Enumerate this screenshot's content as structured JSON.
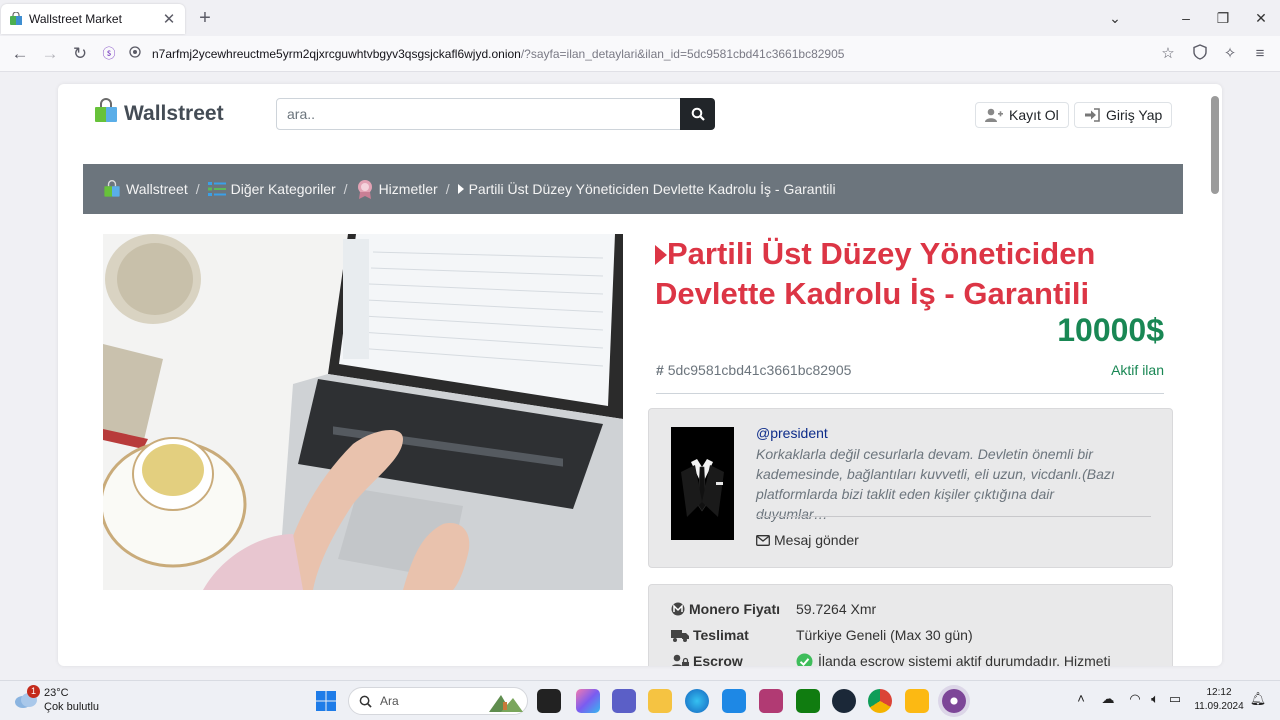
{
  "browser": {
    "tab_title": "Wallstreet Market",
    "url_host": "n7arfmj2ycewhreuctme5yrm2qjxrcguwhtvbgyv3qsgsjckafl6wjyd.onion",
    "url_rest": "/?sayfa=ilan_detaylari&ilan_id=5dc9581cbd41c3661bc82905"
  },
  "site": {
    "logo_text": "Wallstreet",
    "search_placeholder": "ara..",
    "register_label": "Kayıt Ol",
    "login_label": "Giriş Yap"
  },
  "breadcrumb": {
    "home": "Wallstreet",
    "category": "Diğer Kategoriler",
    "subcategory": "Hizmetler",
    "current": "Partili Üst Düzey Yöneticiden Devlette Kadrolu İş - Garantili"
  },
  "listing": {
    "title": "Partili Üst Düzey Yöneticiden Devlette Kadrolu İş - Garantili",
    "price": "10000$",
    "id": "5dc9581cbd41c3661bc82905",
    "status": "Aktif ilan"
  },
  "seller": {
    "username": "@president",
    "bio": "Korkaklarla değil cesurlarla devam. Devletin önemli bir kademesinde, bağlantıları kuvvetli, eli uzun, vicdanlı.(Bazı platformlarda bizi taklit eden kişiler çıktığına dair duyumlar…",
    "message_label": "Mesaj gönder"
  },
  "details": [
    {
      "label": "Monero Fiyatı",
      "value": "59.7264 Xmr"
    },
    {
      "label": "Teslimat",
      "value": "Türkiye Geneli (Max 30 gün)"
    },
    {
      "label": "Escrow",
      "value": "İlanda escrow sistemi aktif durumdadır. Hizmeti"
    }
  ],
  "taskbar": {
    "weather_temp": "23°C",
    "weather_desc": "Çok bulutlu",
    "weather_badge": "1",
    "search_label": "Ara",
    "time": "12:12",
    "date": "11.09.2024"
  },
  "colors": {
    "title_red": "#dc3545",
    "price_green": "#198754",
    "breadcrumb_bg": "#6c757d"
  }
}
